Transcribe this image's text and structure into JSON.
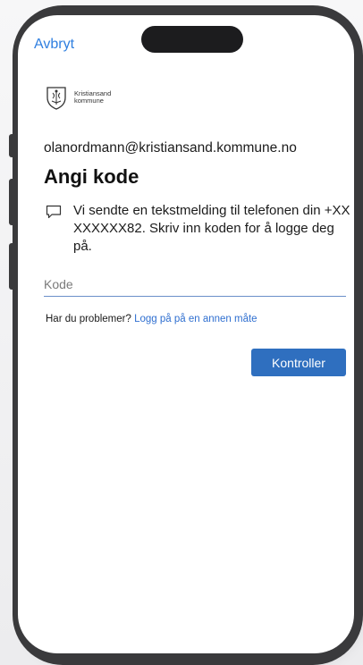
{
  "header": {
    "cancel_label": "Avbryt"
  },
  "org": {
    "name_line1": "Kristiansand",
    "name_line2": "kommune"
  },
  "account": {
    "email": "olanordmann@kristiansand.kommune.no"
  },
  "page": {
    "title": "Angi kode",
    "message": "Vi sendte en tekstmelding til telefonen din +XX XXXXXX82. Skriv inn koden for å logge deg på."
  },
  "form": {
    "code_placeholder": "Kode",
    "code_value": ""
  },
  "help": {
    "question": "Har du problemer?",
    "link": "Logg på på en annen måte"
  },
  "actions": {
    "verify_label": "Kontroller"
  },
  "colors": {
    "link": "#2f7fe0",
    "primary_button": "#2f6fbf",
    "phone_frame": "#3a3a3c"
  }
}
